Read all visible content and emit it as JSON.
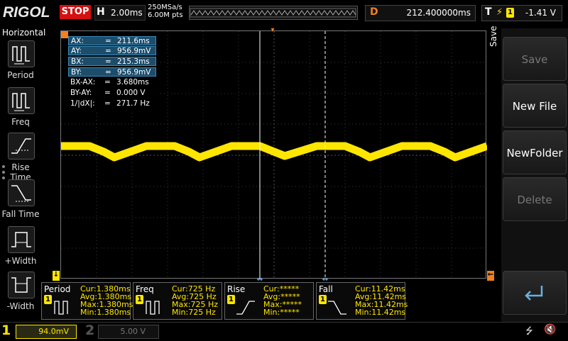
{
  "top": {
    "logo": "RIGOL",
    "run_state": "STOP",
    "h_label": "H",
    "timebase": "2.00ms",
    "sample_rate": "250MSa/s",
    "memory_depth": "6.00M pts",
    "delay_label": "D",
    "delay": "212.400000ms",
    "trigger_label": "T",
    "trigger_channel": "1",
    "trigger_level": "-1.41 V"
  },
  "left_menu": {
    "title": "Horizontal",
    "items": [
      {
        "label": "Period"
      },
      {
        "label": "Freq"
      },
      {
        "label": "Rise Time"
      },
      {
        "label": "Fall Time"
      },
      {
        "label": "+Width"
      },
      {
        "label": "-Width"
      }
    ]
  },
  "cursor_table": [
    {
      "key": "AX:",
      "eq": "=",
      "value": "211.6ms",
      "highlight": true
    },
    {
      "key": "AY:",
      "eq": "=",
      "value": "956.9mV",
      "highlight": true
    },
    {
      "key": "BX:",
      "eq": "=",
      "value": "215.3ms",
      "highlight": true
    },
    {
      "key": "BY:",
      "eq": "=",
      "value": "956.9mV",
      "highlight": true
    },
    {
      "key": "BX-AX:",
      "eq": "=",
      "value": "3.680ms",
      "highlight": false
    },
    {
      "key": "BY-AY:",
      "eq": "=",
      "value": "0.000 V",
      "highlight": false
    },
    {
      "key": "1/|dX|:",
      "eq": "=",
      "value": "271.7 Hz",
      "highlight": false
    }
  ],
  "right_menu": {
    "title": "Save",
    "buttons": [
      {
        "label": "Save",
        "enabled": false
      },
      {
        "label": "New File",
        "enabled": true
      },
      {
        "label": "NewFolder",
        "enabled": true
      },
      {
        "label": "Delete",
        "enabled": false
      },
      {
        "label": "",
        "icon": "return-arrow-icon",
        "enabled": true
      }
    ]
  },
  "measurements": [
    {
      "name": "Period",
      "channel": "1",
      "cur": "Cur:1.380ms",
      "avg": "Avg:1.380ms",
      "max": "Max:1.380ms",
      "min": "Min:1.380ms"
    },
    {
      "name": "Freq",
      "channel": "1",
      "cur": "Cur:725 Hz",
      "avg": "Avg:725 Hz",
      "max": "Max:725 Hz",
      "min": "Min:725 Hz"
    },
    {
      "name": "Rise",
      "channel": "1",
      "cur": "Cur:*****",
      "avg": "Avg:*****",
      "max": "Max:*****",
      "min": "Min:*****"
    },
    {
      "name": "Fall",
      "channel": "1",
      "cur": "Cur:11.42ms",
      "avg": "Avg:11.42ms",
      "max": "Max:11.42ms",
      "min": "Min:11.42ms"
    }
  ],
  "status": {
    "ch1_number": "1",
    "ch1_scale": "94.0mV",
    "ch2_number": "2",
    "ch2_scale": "5.00 V"
  },
  "colors": {
    "ch1": "#ffe600",
    "stop": "#d51010",
    "delay_label": "#f08020",
    "highlight_row": "#1c4d6b"
  }
}
